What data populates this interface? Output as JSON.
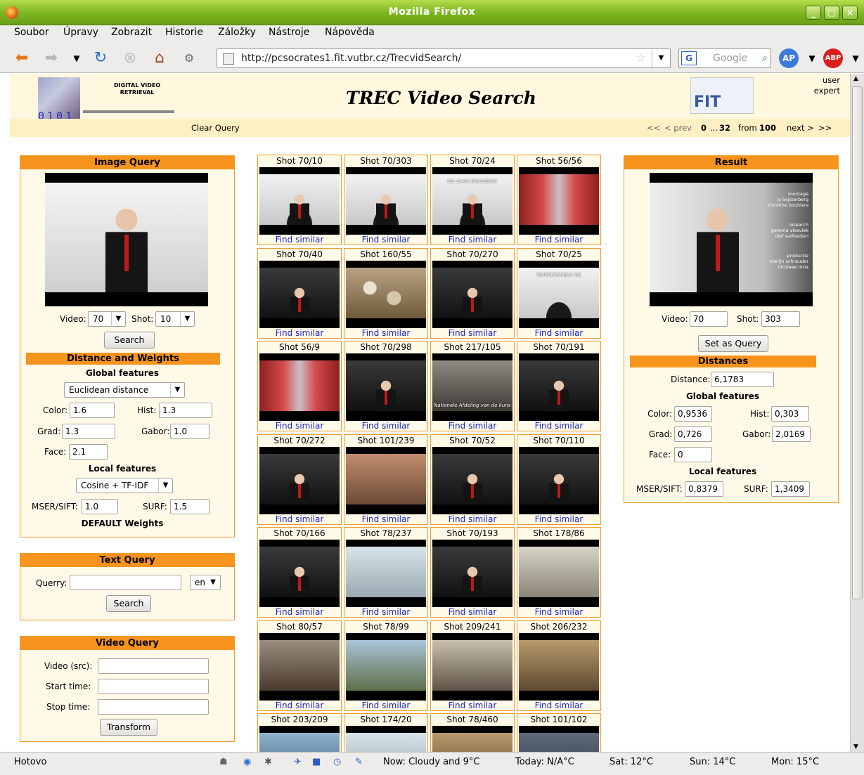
{
  "window": {
    "title": "Mozilla Firefox"
  },
  "menu": [
    "Soubor",
    "Úpravy",
    "Zobrazit",
    "Historie",
    "Záložky",
    "Nástroje",
    "Nápověda"
  ],
  "nav": {
    "url": "http://pcsocrates1.fit.vutbr.cz/TrecvidSearch/",
    "search_placeholder": "Google"
  },
  "header": {
    "logo_text_1": "DIGITAL VIDEO",
    "logo_text_2": "RETRIEVAL",
    "logo_binary": "0101",
    "title": "TREC Video Search",
    "user_1": "user",
    "user_2": "expert",
    "fit_logo": "FIT"
  },
  "pagenav": {
    "clear": "Clear Query",
    "first": "<<",
    "prev": "< prev",
    "range_from": "0",
    "range_sep": "...",
    "range_to": "32",
    "from_label": "from",
    "total": "100",
    "next": "next >",
    "last": ">>"
  },
  "image_query": {
    "title": "Image Query",
    "video_label": "Video:",
    "video_value": "70",
    "shot_label": "Shot:",
    "shot_value": "10",
    "search": "Search"
  },
  "distance": {
    "title": "Distance and Weights",
    "global_title": "Global features",
    "global_metric": "Euclidean distance",
    "color_label": "Color:",
    "color": "1.6",
    "hist_label": "Hist:",
    "hist": "1.3",
    "grad_label": "Grad:",
    "grad": "1.3",
    "gabor_label": "Gabor:",
    "gabor": "1.0",
    "face_label": "Face:",
    "face": "2.1",
    "local_title": "Local features",
    "local_metric": "Cosine + TF-IDF",
    "mser_label": "MSER/SIFT:",
    "mser": "1.0",
    "surf_label": "SURF:",
    "surf": "1.5",
    "default": "DEFAULT Weights"
  },
  "text_query": {
    "title": "Text Query",
    "label": "Querry:",
    "value": "",
    "lang": "en",
    "search": "Search"
  },
  "video_query": {
    "title": "Video Query",
    "src_label": "Video (src):",
    "start_label": "Start time:",
    "stop_label": "Stop time:",
    "src": "",
    "start": "",
    "stop": "",
    "transform": "Transform"
  },
  "grid": {
    "find_label": "Find similar",
    "shots": [
      "Shot 70/10",
      "Shot 70/303",
      "Shot 70/24",
      "Shot 56/56",
      "Shot 70/40",
      "Shot 160/55",
      "Shot 70/270",
      "Shot 70/25",
      "Shot 56/9",
      "Shot 70/298",
      "Shot 217/105",
      "Shot 70/191",
      "Shot 70/272",
      "Shot 101/239",
      "Shot 70/52",
      "Shot 70/110",
      "Shot 70/166",
      "Shot 78/237",
      "Shot 70/193",
      "Shot 178/86",
      "Shot 80/57",
      "Shot 78/99",
      "Shot 209/241",
      "Shot 206/232",
      "Shot 203/209",
      "Shot 174/20",
      "Shot 78/460",
      "Shot 101/102"
    ],
    "overlay_24": "DE ZAAK MILOSEVIC",
    "overlay_25": "Kontkeleinigen bij",
    "overlay_105": "Nationale Afdeling van de kunst"
  },
  "result": {
    "title": "Result",
    "overlay_1": "montage",
    "overlay_2": "jo leijsterberg",
    "overlay_3": "christine bouhiers",
    "overlay_4": "research",
    "overlay_5": "gemma vlosvlek",
    "overlay_6": "olaf sadhadian",
    "overlay_7": "productie",
    "overlay_8": "marijn schreuder",
    "overlay_9": "nicolaee loria",
    "video_label": "Video:",
    "video": "70",
    "shot_label": "Shot:",
    "shot": "303",
    "set_query": "Set as Query",
    "dist_title": "Distances",
    "distance_label": "Distance:",
    "distance": "6,1783",
    "global_title": "Global features",
    "color_label": "Color:",
    "color": "0,9536",
    "hist_label": "Hist:",
    "hist": "0,303",
    "grad_label": "Grad:",
    "grad": "0,726",
    "gabor_label": "Gabor:",
    "gabor": "2,0169",
    "face_label": "Face:",
    "face": "0",
    "local_title": "Local features",
    "mser_label": "MSER/SIFT:",
    "mser": "0,8379",
    "surf_label": "SURF:",
    "surf": "1,3409"
  },
  "status": {
    "text": "Hotovo",
    "now": "Now: Cloudy and 9°C",
    "today": "Today: N/A°C",
    "sat": "Sat: 12°C",
    "sun": "Sun: 14°C",
    "mon": "Mon: 15°C"
  },
  "colors": {
    "accent": "#f7941d",
    "panel_bg": "#fff9e8",
    "header_bg": "#fff8df",
    "link": "#1a25c8"
  }
}
